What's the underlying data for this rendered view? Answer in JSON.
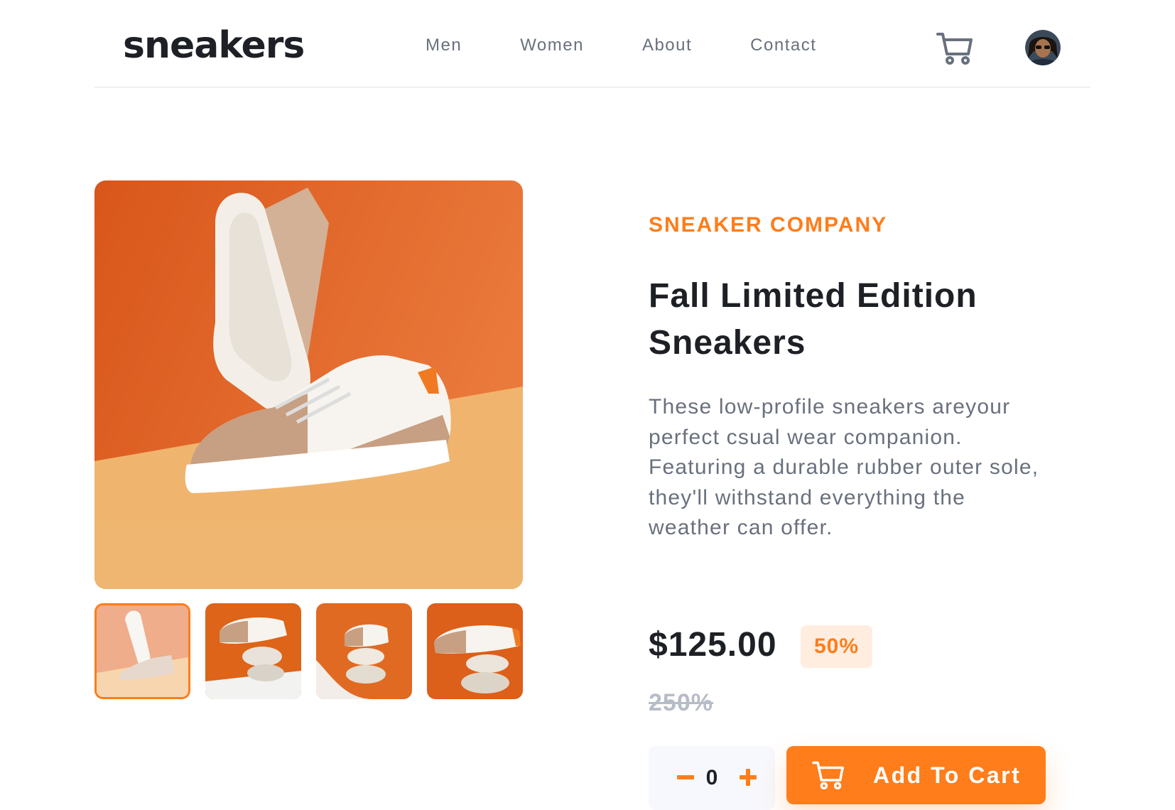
{
  "header": {
    "logo": "sneakers",
    "nav": [
      "Men",
      "Women",
      "About",
      "Contact"
    ]
  },
  "product": {
    "company": "SNEAKER COMPANY",
    "title": "Fall Limited Edition Sneakers",
    "description": "These low-profile sneakers areyour perfect csual wear companion. Featuring a durable rubber outer sole, they'll withstand everything the weather can offer.",
    "price": "$125.00",
    "discount": "50%",
    "original_price": "250%"
  },
  "cart": {
    "quantity": "0",
    "add_label": "Add To Cart"
  },
  "gallery": {
    "active_index": 0
  },
  "colors": {
    "accent": "#ff7d1a",
    "accent_pale": "#ffede0",
    "text_dark": "#1d2025",
    "text_gray": "#69707d"
  },
  "icons": [
    "cart-icon",
    "avatar",
    "minus-icon",
    "plus-icon"
  ]
}
